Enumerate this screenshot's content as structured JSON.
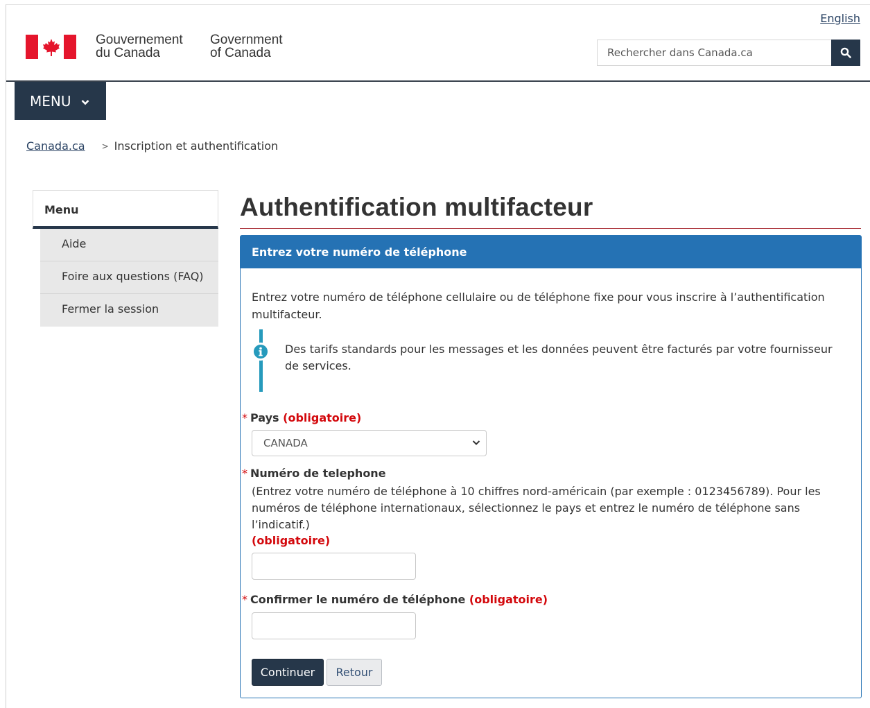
{
  "header": {
    "language_link": "English",
    "signature_fr_line1": "Gouvernement",
    "signature_fr_line2": "du Canada",
    "signature_en_line1": "Government",
    "signature_en_line2": "of Canada",
    "search_placeholder": "Rechercher dans Canada.ca",
    "search_icon": "search-icon",
    "flag_color": "#e5152c",
    "bar_color": "#26374a"
  },
  "menu": {
    "label": "MENU",
    "icon": "chevron-down-icon"
  },
  "breadcrumb": {
    "home": "Canada.ca",
    "separator": ">",
    "current": "Inscription et authentification"
  },
  "sidenav": {
    "title": "Menu",
    "items": [
      "Aide",
      "Foire aux questions (FAQ)",
      "Fermer la session"
    ]
  },
  "main": {
    "title": "Authentification multifacteur",
    "panel_title": "Entrez votre numéro de téléphone",
    "intro": "Entrez votre numéro de téléphone cellulaire ou de téléphone fixe pour vous inscrire à l’authentification multifacteur.",
    "info": "Des tarifs standards pour les messages et les données peuvent être facturés par votre fournisseur de services.",
    "info_icon": "info-icon",
    "country": {
      "star": "*",
      "label": "Pays",
      "required": "(obligatoire)",
      "value": "CANADA"
    },
    "phone": {
      "star": "*",
      "label": "Numéro de telephone",
      "help": "(Entrez votre numéro de téléphone à 10 chiffres nord-américain (par exemple : 0123456789). Pour les numéros de téléphone internationaux, sélectionnez le pays et entrez le numéro de téléphone sans l’indicatif.)",
      "required": "(obligatoire)",
      "value": ""
    },
    "confirm": {
      "star": "*",
      "label": "Confirmer le numéro de téléphone",
      "required": "(obligatoire)",
      "value": ""
    },
    "continue_label": "Continuer",
    "back_label": "Retour",
    "accent_color": "#2572b4",
    "required_color": "#d3080c"
  }
}
